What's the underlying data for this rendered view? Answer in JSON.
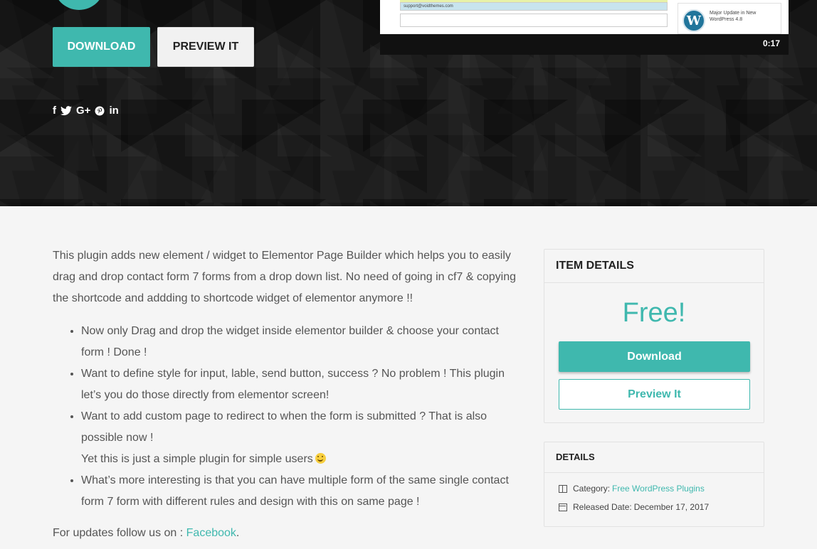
{
  "hero": {
    "download_label": "DOWNLOAD",
    "preview_label": "PREVIEW IT",
    "social": [
      "f",
      "t",
      "G+",
      "p",
      "in"
    ]
  },
  "video": {
    "email": "support@voidthemes.com",
    "card_title": "Major Update in New WordPress 4.8",
    "time": "0:17"
  },
  "content": {
    "intro": "This plugin adds new element / widget to Elementor Page Builder which helps you to easily drag and drop contact form 7 forms from a drop down list. No need of going in cf7 & copying the shortcode and addding to shortcode widget of elementor anymore !!",
    "bullets": [
      "Now only Drag and drop the widget inside elementor builder & choose your contact form ! Done !",
      "Want to define style for input, lable, send button, success ? No problem ! This plugin let’s you do those directly from elementor screen!",
      "Want to add custom page to redirect to when the form is submitted ? That is also possible now !",
      "What’s more interesting is that you can have multiple form of the same single contact form 7 form with different rules and design with this on same page !"
    ],
    "bullet3_extra": "Yet this is just a simple plugin for simple users",
    "follow_prefix": "For updates follow us on : ",
    "follow_link": "Facebook",
    "follow_suffix": "."
  },
  "item_details": {
    "title": "ITEM DETAILS",
    "price": "Free!",
    "download_label": "Download",
    "preview_label": "Preview It"
  },
  "details": {
    "title": "DETAILS",
    "category_label": "Category:",
    "category_value": "Free WordPress Plugins",
    "released_label": "Released Date:",
    "released_value": "December 17, 2017"
  },
  "colors": {
    "accent": "#3fb8ae",
    "hero_bg": "#1c1c1c",
    "page_bg": "#f5f5f5"
  }
}
